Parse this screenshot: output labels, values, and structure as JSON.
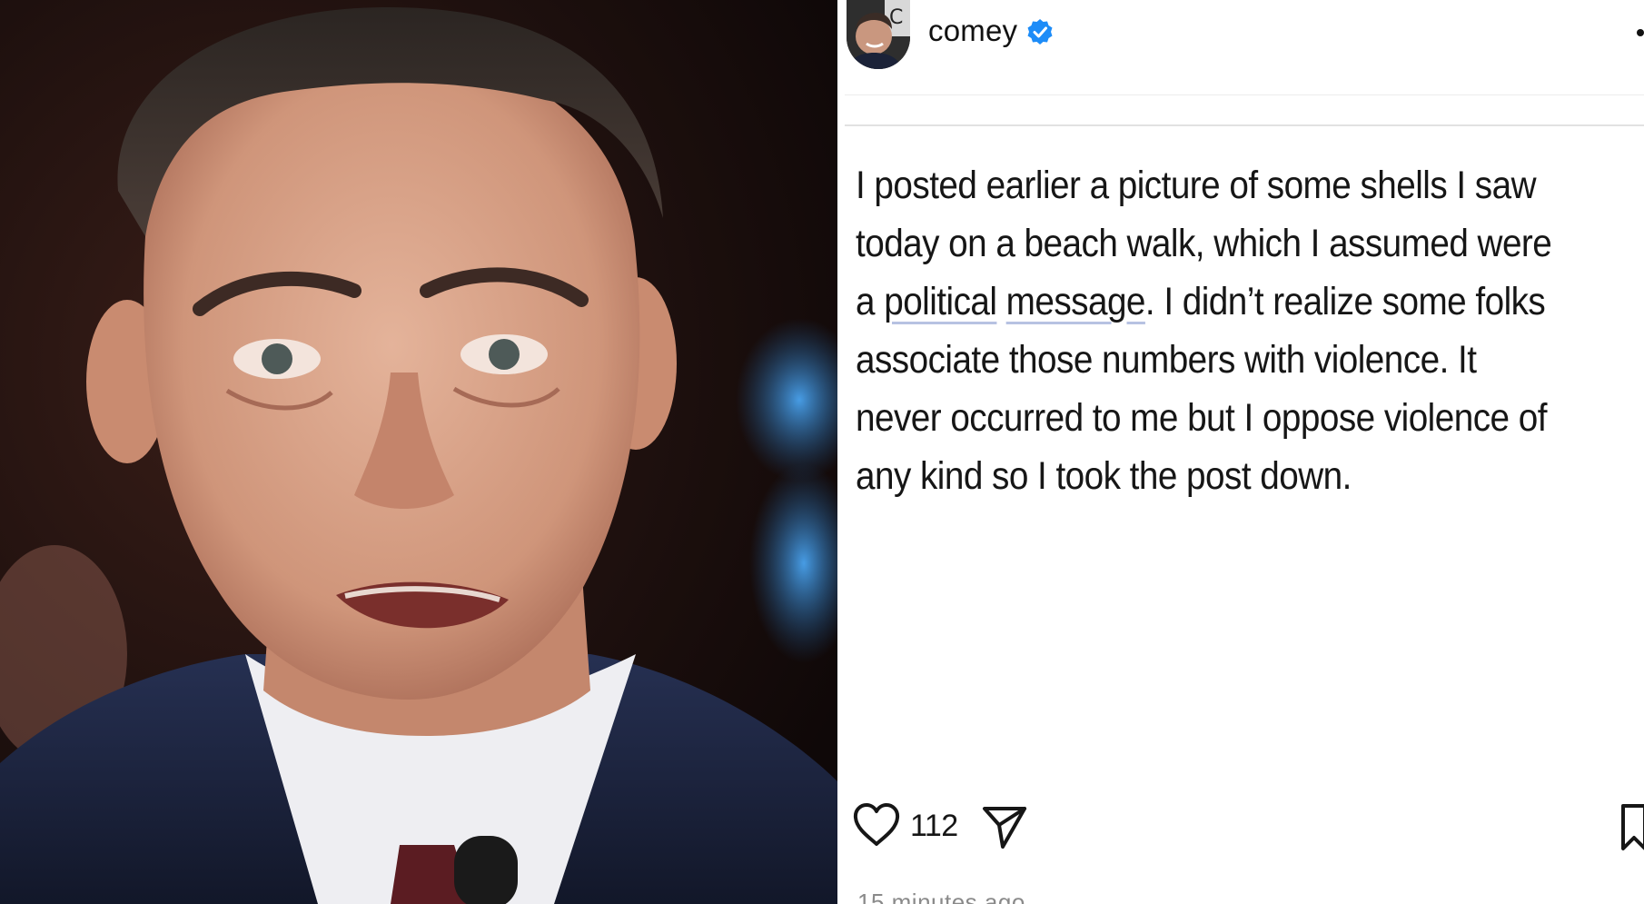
{
  "photo": {
    "description_icon": "portrait-photo",
    "colors": {
      "background": "#1a0f0e",
      "skin": "#d9a58c",
      "suit": "#1b2238",
      "shirt": "#f1f1f3",
      "blue_bokeh": "#2f82c8"
    }
  },
  "post": {
    "username": "comey",
    "verified_icon": "verified-badge-icon",
    "more_icon": "more-options-icon",
    "text_lines": [
      "I posted earlier a picture of some shells I saw",
      "today on a beach walk, which I assumed were",
      "a",
      "political",
      "message",
      ". I didn’t realize some folks",
      "associate those numbers with violence. It",
      "never occurred to me but I oppose violence of",
      "any kind so I took the post down."
    ],
    "like_count": "112",
    "timestamp": "15 minutes ago",
    "colors": {
      "text": "#161616",
      "verified": "#1d8cf8",
      "underline": "#b7c2e2"
    }
  }
}
